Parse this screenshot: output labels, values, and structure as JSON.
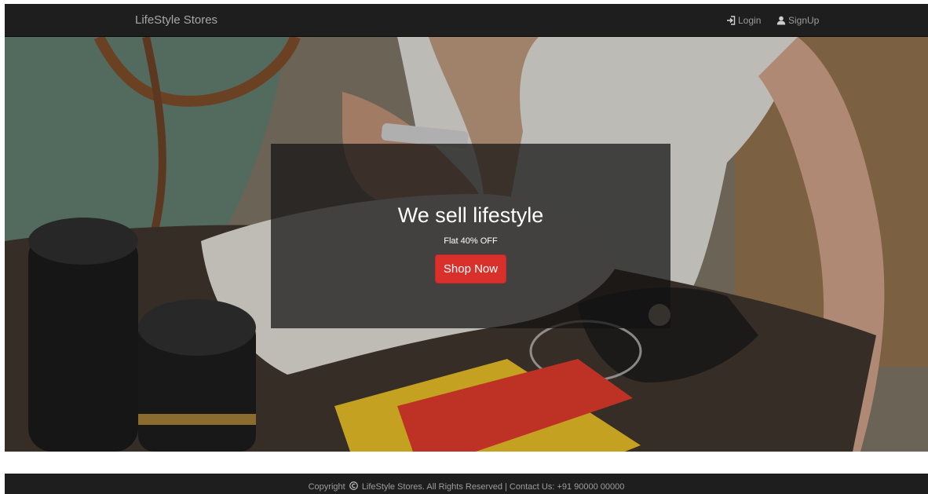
{
  "navbar": {
    "brand": "LifeStyle Stores",
    "login_label": "Login",
    "login_icon": "login-icon",
    "signup_label": "SignUp",
    "signup_icon": "user-icon"
  },
  "hero": {
    "title": "We sell lifestyle",
    "subtitle": "Flat 40% OFF",
    "button_label": "Shop Now",
    "button_color": "#d9302c"
  },
  "footer": {
    "copyright_prefix": "Copyright",
    "copyright_icon": "copyright-icon",
    "copyright_text": "LifeStyle Stores. All Rights Reserved | Contact Us: +91 90000 00000"
  }
}
